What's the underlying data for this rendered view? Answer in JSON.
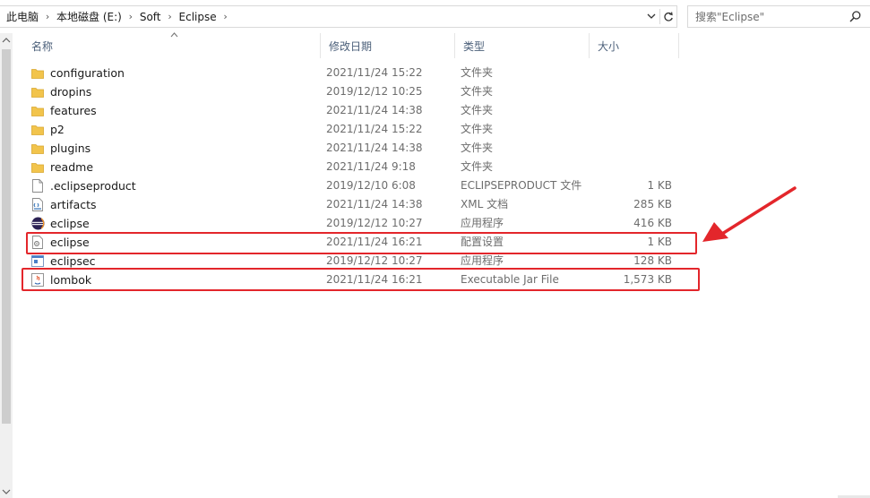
{
  "address": {
    "crumbs": [
      "此电脑",
      "本地磁盘 (E:)",
      "Soft",
      "Eclipse"
    ]
  },
  "search": {
    "placeholder": "搜索\"Eclipse\""
  },
  "columns": {
    "name": "名称",
    "date": "修改日期",
    "type": "类型",
    "size": "大小"
  },
  "files": [
    {
      "name": "configuration",
      "date": "2021/11/24 15:22",
      "type": "文件夹",
      "size": "",
      "icon": "folder-icon"
    },
    {
      "name": "dropins",
      "date": "2019/12/12 10:25",
      "type": "文件夹",
      "size": "",
      "icon": "folder-icon"
    },
    {
      "name": "features",
      "date": "2021/11/24 14:38",
      "type": "文件夹",
      "size": "",
      "icon": "folder-icon"
    },
    {
      "name": "p2",
      "date": "2021/11/24 15:22",
      "type": "文件夹",
      "size": "",
      "icon": "folder-icon"
    },
    {
      "name": "plugins",
      "date": "2021/11/24 14:38",
      "type": "文件夹",
      "size": "",
      "icon": "folder-icon"
    },
    {
      "name": "readme",
      "date": "2021/11/24 9:18",
      "type": "文件夹",
      "size": "",
      "icon": "folder-icon"
    },
    {
      "name": ".eclipseproduct",
      "date": "2019/12/10 6:08",
      "type": "ECLIPSEPRODUCT 文件",
      "size": "1 KB",
      "icon": "blank-file-icon"
    },
    {
      "name": "artifacts",
      "date": "2021/11/24 14:38",
      "type": "XML 文档",
      "size": "285 KB",
      "icon": "xml-file-icon"
    },
    {
      "name": "eclipse",
      "date": "2019/12/12 10:27",
      "type": "应用程序",
      "size": "416 KB",
      "icon": "eclipse-app-icon"
    },
    {
      "name": "eclipse",
      "date": "2021/11/24 16:21",
      "type": "配置设置",
      "size": "1 KB",
      "icon": "ini-file-icon"
    },
    {
      "name": "eclipsec",
      "date": "2019/12/12 10:27",
      "type": "应用程序",
      "size": "128 KB",
      "icon": "console-app-icon"
    },
    {
      "name": "lombok",
      "date": "2021/11/24 16:21",
      "type": "Executable Jar File",
      "size": "1,573 KB",
      "icon": "jar-file-icon"
    }
  ],
  "colors": {
    "highlight": "#e3262b",
    "header_text": "#4c607a",
    "folder": "#f2c44c"
  }
}
